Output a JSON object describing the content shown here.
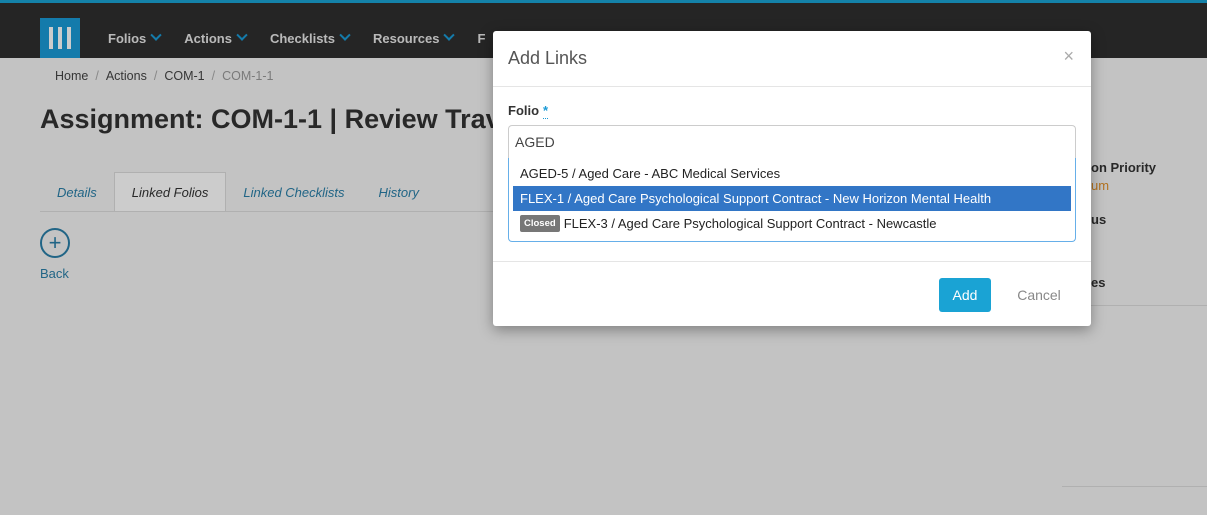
{
  "nav": {
    "items": [
      {
        "label": "Folios"
      },
      {
        "label": "Actions"
      },
      {
        "label": "Checklists"
      },
      {
        "label": "Resources"
      },
      {
        "label": "F"
      }
    ]
  },
  "breadcrumb": {
    "items": [
      "Home",
      "Actions",
      "COM-1"
    ],
    "current": "COM-1-1"
  },
  "page": {
    "title": "Assignment:  COM-1-1 | Review Trav"
  },
  "tabs": [
    "Details",
    "Linked Folios",
    "Linked Checklists",
    "History"
  ],
  "back": {
    "label": "Back"
  },
  "side": {
    "priority_label": "on Priority",
    "priority_value": "um",
    "status_label": "us",
    "frag_label": "es"
  },
  "modal": {
    "title": "Add Links",
    "close": "×",
    "field_label": "Folio",
    "required_mark": "*",
    "input_value": "AGED",
    "options": [
      {
        "text": "AGED-5 / Aged Care - ABC Medical Services",
        "badge": ""
      },
      {
        "text": "FLEX-1 / Aged Care Psychological Support Contract - New Horizon Mental Health",
        "badge": "",
        "highlighted": true
      },
      {
        "text": "FLEX-3 / Aged Care Psychological Support Contract - Newcastle",
        "badge": "Closed"
      }
    ],
    "add_label": "Add",
    "cancel_label": "Cancel"
  }
}
